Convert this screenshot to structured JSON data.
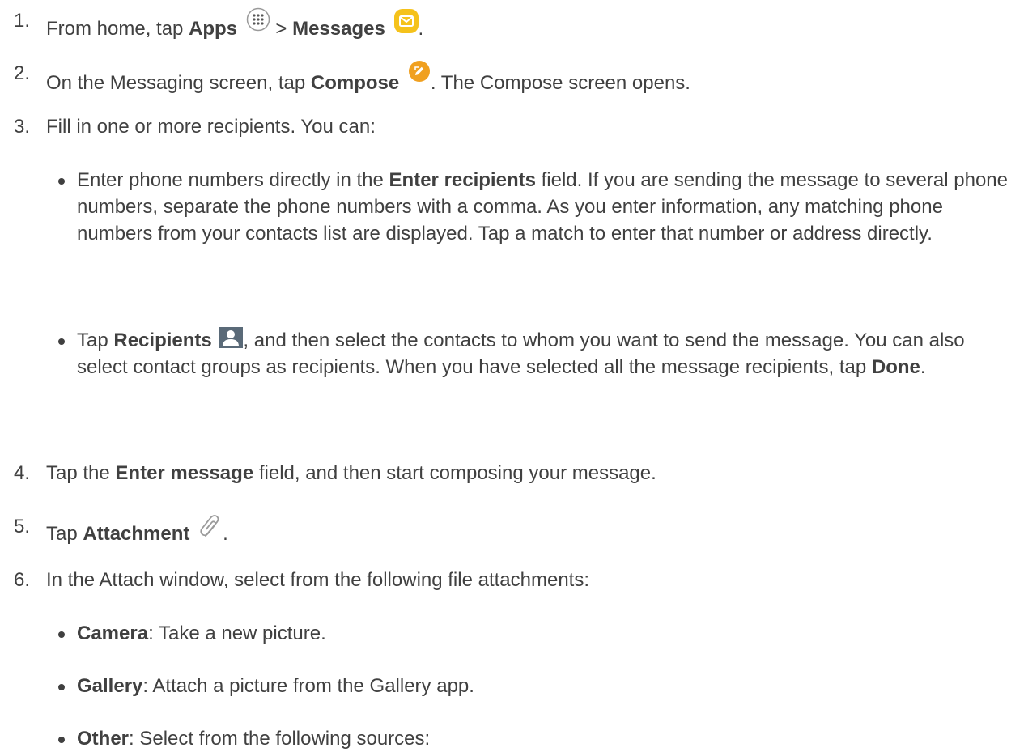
{
  "steps": [
    {
      "num": "1.",
      "t1": "From home, tap ",
      "b1": "Apps",
      "sep": " > ",
      "b2": "Messages",
      "end": ".",
      "icons": [
        "apps-grid-icon",
        "messages-envelope-icon"
      ]
    },
    {
      "num": "2.",
      "t1": "On the Messaging screen, tap ",
      "b1": "Compose",
      "t2": ". The Compose screen opens.",
      "icons": [
        "compose-pencil-icon"
      ]
    },
    {
      "num": "3.",
      "t1": "Fill in one or more recipients. You can:",
      "bullets": [
        {
          "t1": "Enter phone numbers directly in the ",
          "b1": "Enter recipients",
          "t2": " field. If you are sending the message to several phone numbers, separate the phone numbers with a comma. As you enter information, any matching phone numbers from your contacts list are displayed. Tap a match to enter that number or address directly."
        },
        {
          "t1": "Tap ",
          "b1": "Recipients",
          "t2": ", and then select the contacts to whom you want to send the message. You can also select contact groups as recipients. When you have selected all the message recipients, tap ",
          "b2": "Done",
          "t3": ".",
          "icons": [
            "contact-person-icon"
          ]
        }
      ]
    },
    {
      "num": "4.",
      "t1": "Tap the ",
      "b1": "Enter message",
      "t2": " field, and then start composing your message."
    },
    {
      "num": "5.",
      "t1": "Tap ",
      "b1": "Attachment",
      "t2": ".",
      "icons": [
        "paperclip-icon"
      ]
    },
    {
      "num": "6.",
      "t1": "In the Attach window, select from the following file attachments:",
      "bullets": [
        {
          "b1": "Camera",
          "t1": ": Take a new picture."
        },
        {
          "b1": "Gallery",
          "t1": ": Attach a picture from the Gallery app."
        },
        {
          "b1": "Other",
          "t1": ": Select from the following sources:"
        }
      ]
    }
  ],
  "colors": {
    "text": "#404040",
    "messages_icon": "#f5c21b",
    "compose_icon": "#f0a020",
    "contact_icon": "#5a6a78"
  }
}
